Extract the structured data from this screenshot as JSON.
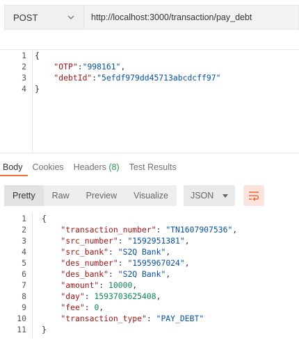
{
  "request": {
    "method": "POST",
    "url": "http://localhost:3000/transaction/pay_debt",
    "body_lines": [
      {
        "n": "1",
        "parts": [
          {
            "t": "{",
            "c": "punc"
          }
        ]
      },
      {
        "n": "2",
        "parts": [
          {
            "t": "    \"OTP\"",
            "c": "key"
          },
          {
            "t": ":",
            "c": "punc"
          },
          {
            "t": "\"998161\"",
            "c": "str"
          },
          {
            "t": ",",
            "c": "punc"
          }
        ]
      },
      {
        "n": "3",
        "parts": [
          {
            "t": "    \"debtId\"",
            "c": "key"
          },
          {
            "t": ":",
            "c": "punc"
          },
          {
            "t": "\"5efdf979dd45713abcdcff97\"",
            "c": "str"
          }
        ]
      },
      {
        "n": "4",
        "parts": [
          {
            "t": "}",
            "c": "punc"
          }
        ]
      }
    ]
  },
  "response": {
    "tabs": [
      {
        "label": "Body",
        "badge": "",
        "active": true
      },
      {
        "label": "Cookies",
        "badge": "",
        "active": false
      },
      {
        "label": "Headers",
        "badge": "(8)",
        "active": false
      },
      {
        "label": "Test Results",
        "badge": "",
        "active": false
      }
    ],
    "view_modes": [
      {
        "label": "Pretty",
        "active": true
      },
      {
        "label": "Raw",
        "active": false
      },
      {
        "label": "Preview",
        "active": false
      },
      {
        "label": "Visualize",
        "active": false
      }
    ],
    "format": "JSON",
    "body_lines": [
      {
        "n": "1",
        "parts": [
          {
            "t": "{",
            "c": "punc"
          }
        ]
      },
      {
        "n": "2",
        "parts": [
          {
            "t": "    \"transaction_number\"",
            "c": "key"
          },
          {
            "t": ": ",
            "c": "punc"
          },
          {
            "t": "\"TN1607907536\"",
            "c": "str"
          },
          {
            "t": ",",
            "c": "punc"
          }
        ]
      },
      {
        "n": "3",
        "parts": [
          {
            "t": "    \"src_number\"",
            "c": "key"
          },
          {
            "t": ": ",
            "c": "punc"
          },
          {
            "t": "\"1592951381\"",
            "c": "str"
          },
          {
            "t": ",",
            "c": "punc"
          }
        ]
      },
      {
        "n": "4",
        "parts": [
          {
            "t": "    \"src_bank\"",
            "c": "key"
          },
          {
            "t": ": ",
            "c": "punc"
          },
          {
            "t": "\"S2Q Bank\"",
            "c": "str"
          },
          {
            "t": ",",
            "c": "punc"
          }
        ]
      },
      {
        "n": "5",
        "parts": [
          {
            "t": "    \"des_number\"",
            "c": "key"
          },
          {
            "t": ": ",
            "c": "punc"
          },
          {
            "t": "\"1595967024\"",
            "c": "str"
          },
          {
            "t": ",",
            "c": "punc"
          }
        ]
      },
      {
        "n": "6",
        "parts": [
          {
            "t": "    \"des_bank\"",
            "c": "key"
          },
          {
            "t": ": ",
            "c": "punc"
          },
          {
            "t": "\"S2Q Bank\"",
            "c": "str"
          },
          {
            "t": ",",
            "c": "punc"
          }
        ]
      },
      {
        "n": "7",
        "parts": [
          {
            "t": "    \"amount\"",
            "c": "key"
          },
          {
            "t": ": ",
            "c": "punc"
          },
          {
            "t": "10000",
            "c": "num"
          },
          {
            "t": ",",
            "c": "punc"
          }
        ]
      },
      {
        "n": "8",
        "parts": [
          {
            "t": "    \"day\"",
            "c": "key"
          },
          {
            "t": ": ",
            "c": "punc"
          },
          {
            "t": "1593703625408",
            "c": "num"
          },
          {
            "t": ",",
            "c": "punc"
          }
        ]
      },
      {
        "n": "9",
        "parts": [
          {
            "t": "    \"fee\"",
            "c": "key"
          },
          {
            "t": ": ",
            "c": "punc"
          },
          {
            "t": "0",
            "c": "num"
          },
          {
            "t": ",",
            "c": "punc"
          }
        ]
      },
      {
        "n": "10",
        "parts": [
          {
            "t": "    \"transaction_type\"",
            "c": "key"
          },
          {
            "t": ": ",
            "c": "punc"
          },
          {
            "t": "\"PAY_DEBT\"",
            "c": "str"
          }
        ]
      },
      {
        "n": "11",
        "parts": [
          {
            "t": "}",
            "c": "punc"
          }
        ]
      }
    ]
  },
  "icons": {
    "method_dropdown": "chevron-down-icon",
    "format_dropdown": "caret-down-icon",
    "wrap": "text-wrap-icon"
  },
  "colors": {
    "accent": "#f26b3a",
    "json_key": "#a31515",
    "json_string": "#0451a5",
    "json_number": "#098658",
    "badge": "#2e9a4a"
  }
}
